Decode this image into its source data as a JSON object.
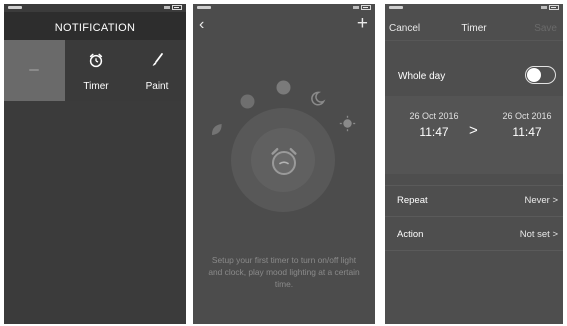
{
  "panel1": {
    "title": "NOTIFICATION",
    "tiles": [
      {
        "label": "Timer",
        "icon": "alarm-clock-icon"
      },
      {
        "label": "Paint",
        "icon": "brush-icon"
      }
    ]
  },
  "panel2": {
    "back_icon": "chevron-left-icon",
    "add_icon": "plus-icon",
    "glyph_back": "‹",
    "glyph_add": "+",
    "hint": "Setup your first timer to turn on/off light and clock, play mood lighting at a certain time."
  },
  "panel3": {
    "cancel": "Cancel",
    "title": "Timer",
    "save": "Save",
    "whole_day_label": "Whole day",
    "whole_day_on": false,
    "start": {
      "date": "26 Oct 2016",
      "time": "11:47"
    },
    "end": {
      "date": "26 Oct 2016",
      "time": "11:47"
    },
    "arrow": ">",
    "repeat_label": "Repeat",
    "repeat_value": "Never >",
    "action_label": "Action",
    "action_value": "Not set >"
  },
  "colors": {
    "bg_dark": "#3b3b3b",
    "bg_mid": "#4c4c4c",
    "accent_white": "#ffffff",
    "muted_text": "#8a8a8a"
  }
}
